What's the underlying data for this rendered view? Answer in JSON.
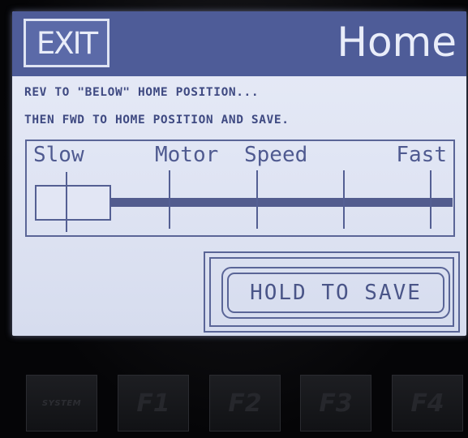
{
  "header": {
    "exit_label": "EXIT",
    "title": "Home"
  },
  "messages": {
    "line1": "REV TO \"BELOW\" HOME POSITION...",
    "line2": "THEN FWD TO HOME POSITION AND SAVE."
  },
  "speed_control": {
    "label_slow": "Slow",
    "label_motor": "Motor",
    "label_speed": "Speed",
    "label_fast": "Fast",
    "setting_fraction": 0.0
  },
  "save_button": {
    "label": "HOLD TO SAVE"
  },
  "function_keys": [
    {
      "label": "SYSTEM"
    },
    {
      "label": "F1"
    },
    {
      "label": "F2"
    },
    {
      "label": "F3"
    },
    {
      "label": "F4"
    }
  ],
  "colors": {
    "header": "#4e5c98",
    "screen": "#e3e8f6",
    "ink": "#4a5588"
  }
}
